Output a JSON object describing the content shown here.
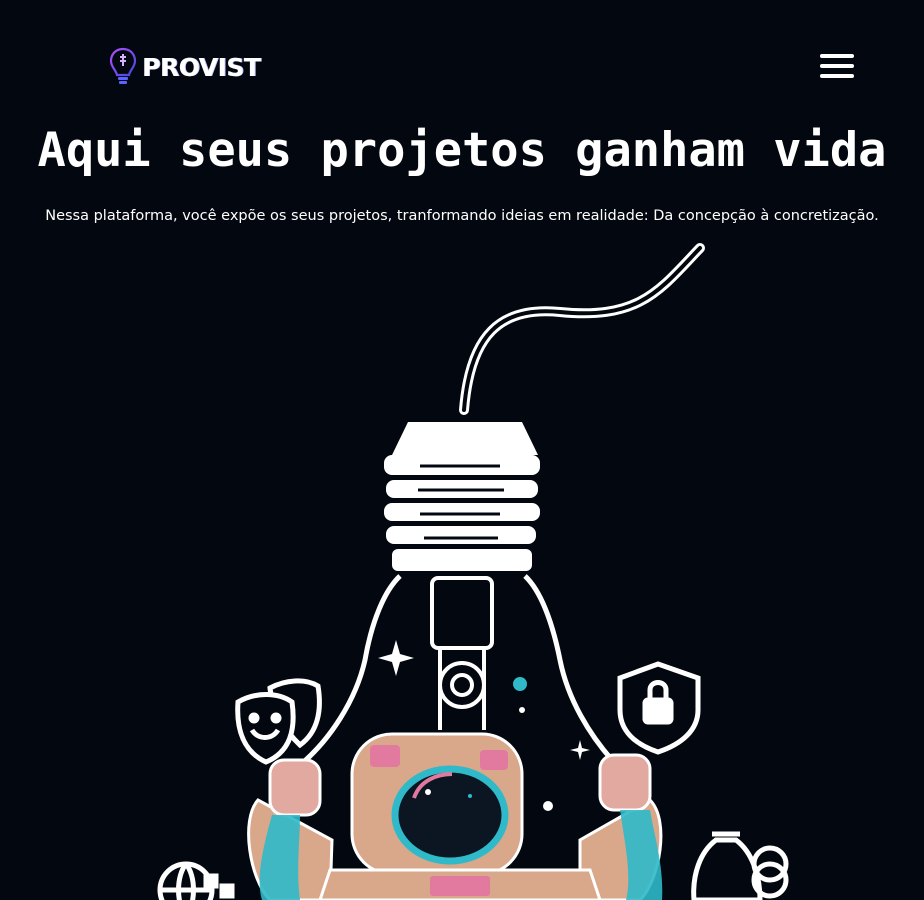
{
  "header": {
    "logo_text": "PROVIST",
    "logo_icon": "lightbulb-icon",
    "menu_icon": "hamburger-menu-icon"
  },
  "hero": {
    "title": "Aqui seus projetos ganham vida",
    "subtitle": "Nessa plataforma, você expõe os seus projetos, tranformando ideias em realidade: Da concepção à concretização."
  },
  "colors": {
    "background": "#030810",
    "text": "#ffffff",
    "logo_accent": "#7a3cff",
    "suit": "#d9a88a",
    "suit_pink": "#e27aa0",
    "visor_teal": "#2fb9c9"
  }
}
